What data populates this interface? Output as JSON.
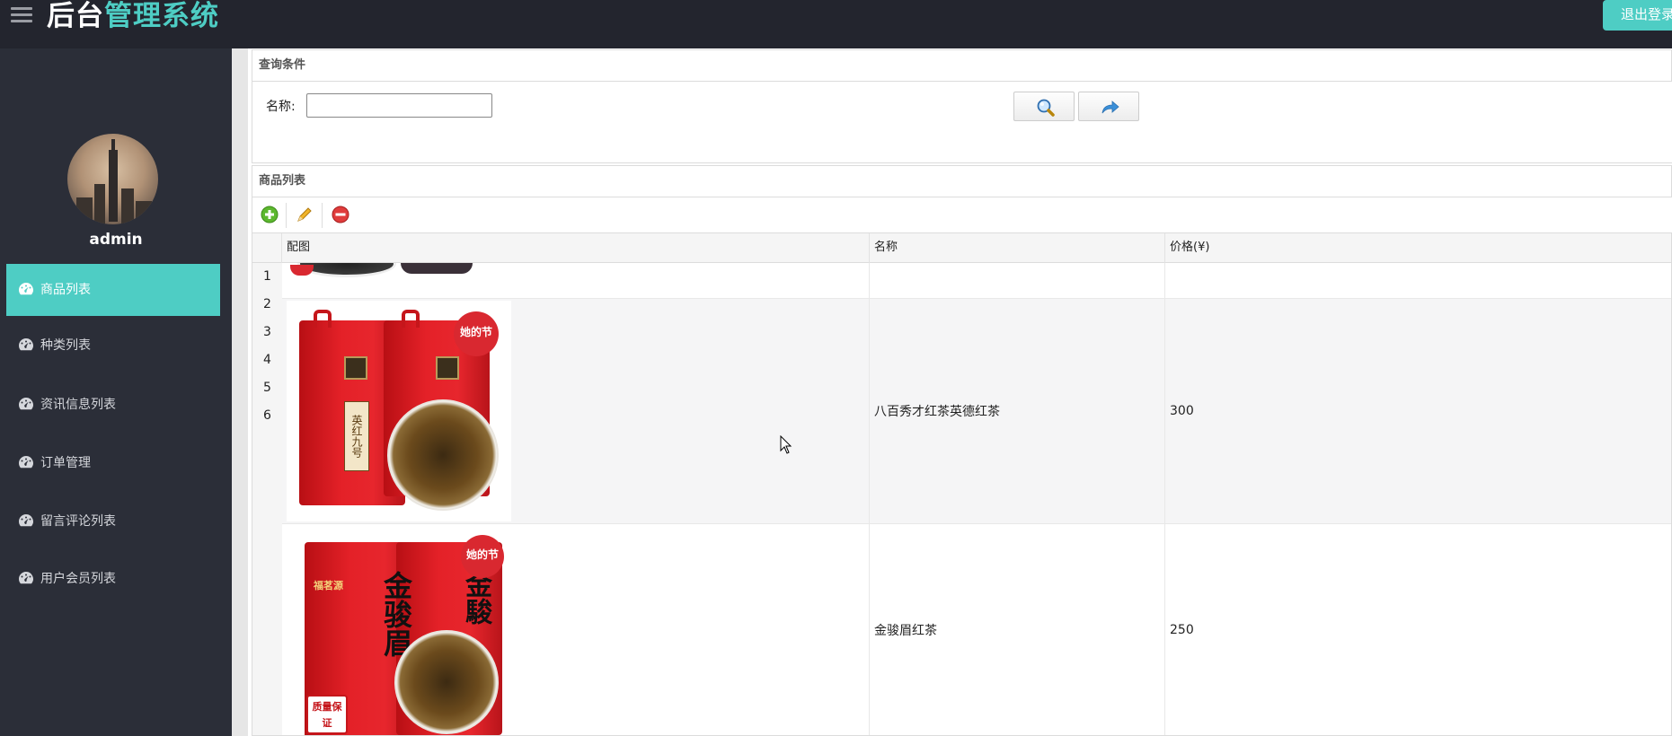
{
  "header": {
    "brand_part1": "后台",
    "brand_part2": "管理系统",
    "logout_label": "退出登录"
  },
  "user": {
    "name": "admin"
  },
  "sidebar": {
    "items": [
      {
        "label": "商品列表",
        "active": true
      },
      {
        "label": "种类列表"
      },
      {
        "label": "资讯信息列表"
      },
      {
        "label": "订单管理"
      },
      {
        "label": "留言评论列表"
      },
      {
        "label": "用户会员列表"
      }
    ]
  },
  "query": {
    "title": "查询条件",
    "name_label": "名称:",
    "name_value": "",
    "search_icon": "search-icon",
    "reset_icon": "redo-arrow-icon"
  },
  "list": {
    "title": "商品列表",
    "toolbar": [
      "add-icon",
      "edit-icon",
      "delete-icon"
    ],
    "columns": [
      "配图",
      "名称",
      "价格(¥)"
    ],
    "row_numbers": [
      "1",
      "2",
      "3",
      "4",
      "5",
      "6"
    ],
    "rows": [
      {
        "name": "",
        "price": ""
      },
      {
        "name": "八百秀才红茶英德红茶",
        "price": "300",
        "image_text": [
          "英红九号",
          "她的节"
        ]
      },
      {
        "name": "金骏眉红茶",
        "price": "250",
        "image_text": [
          "金骏眉",
          "福茗源",
          "她的节",
          "质量保证"
        ]
      }
    ]
  },
  "colors": {
    "accent": "#4ecdc4",
    "topbar": "#23252e",
    "sidebar": "#2b2e38"
  }
}
